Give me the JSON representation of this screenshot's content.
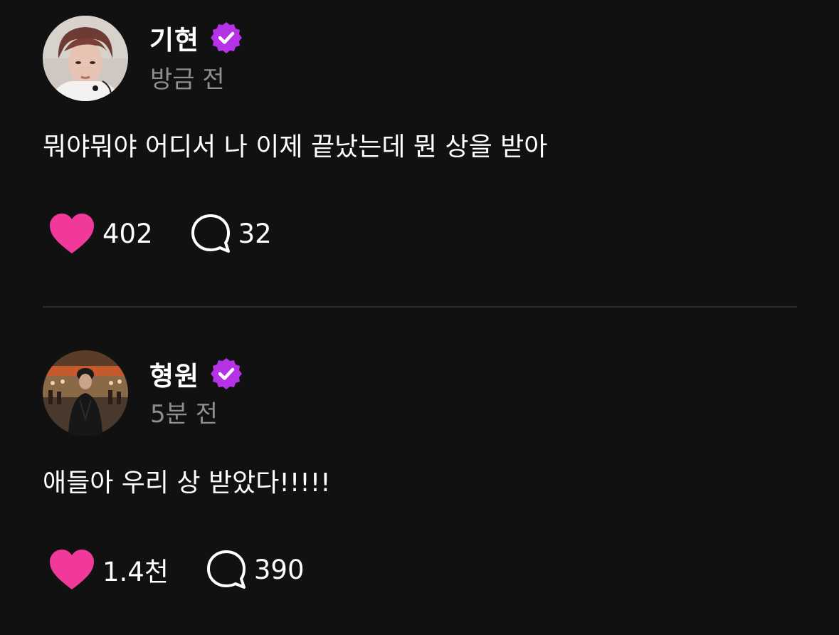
{
  "posts": [
    {
      "author": "기현",
      "time": "방금 전",
      "text": "뭐야뭐야 어디서 나 이제 끝났는데 뭔 상을 받아",
      "likes": "402",
      "comments": "32"
    },
    {
      "author": "형원",
      "time": "5분 전",
      "text": "애들아 우리 상 받았다!!!!!",
      "likes": "1.4천",
      "comments": "390"
    }
  ],
  "colors": {
    "background": "#111112",
    "heart": "#f0399a",
    "verified": "#b632e6",
    "muted_text": "#8e8e93"
  },
  "icons": {
    "verified": "verified-badge-icon",
    "like": "heart-icon",
    "comment": "comment-bubble-icon"
  }
}
